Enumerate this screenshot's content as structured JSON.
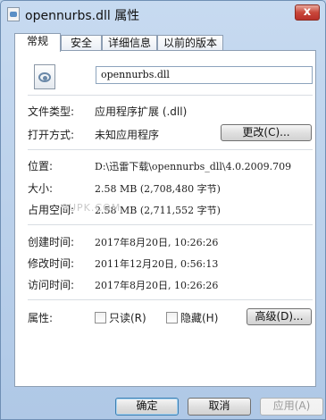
{
  "window": {
    "title": "opennurbs.dll 属性",
    "close_label": "x"
  },
  "tabs": [
    {
      "label": "常规"
    },
    {
      "label": "安全"
    },
    {
      "label": "详细信息"
    },
    {
      "label": "以前的版本"
    }
  ],
  "general": {
    "filename": "opennurbs.dll",
    "file_type": {
      "label": "文件类型:",
      "value": "应用程序扩展 (.dll)"
    },
    "opens_with": {
      "label": "打开方式:",
      "value": "未知应用程序",
      "button": "更改(C)..."
    },
    "location": {
      "label": "位置:",
      "value": "D:\\迅雷下载\\opennurbs_dll\\4.0.2009.709"
    },
    "size": {
      "label": "大小:",
      "value": "2.58 MB (2,708,480 字节)"
    },
    "size_on_disk": {
      "label": "占用空间:",
      "value": "2.58 MB (2,711,552 字节)"
    },
    "created": {
      "label": "创建时间:",
      "value": "2017年8月20日, 10:26:26"
    },
    "modified": {
      "label": "修改时间:",
      "value": "2011年12月20日, 0:56:13"
    },
    "accessed": {
      "label": "访问时间:",
      "value": "2017年8月20日, 10:26:26"
    },
    "attributes": {
      "label": "属性:",
      "readonly": "只读(R)",
      "hidden": "隐藏(H)",
      "advanced_button": "高级(D)..."
    },
    "watermark": "9UPK.COM"
  },
  "footer": {
    "ok": "确定",
    "cancel": "取消",
    "apply": "应用(A)"
  }
}
